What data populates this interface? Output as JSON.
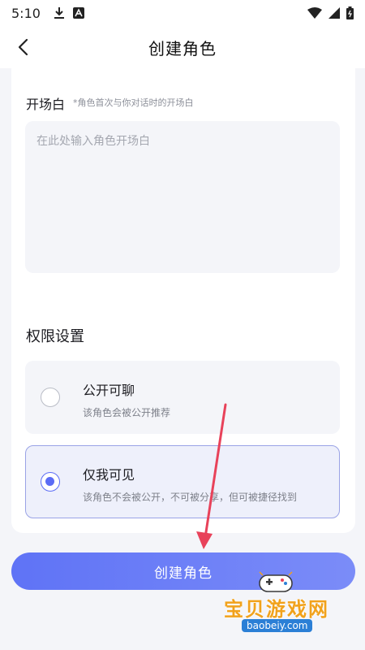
{
  "status_bar": {
    "time": "5:10"
  },
  "nav": {
    "title": "创建角色"
  },
  "opening": {
    "title": "开场白",
    "hint": "*角色首次与你对话时的开场白",
    "placeholder": "在此处输入角色开场白"
  },
  "permissions": {
    "title": "权限设置",
    "options": [
      {
        "label": "公开可聊",
        "desc": "该角色会被公开推荐",
        "selected": false
      },
      {
        "label": "仅我可见",
        "desc": "该角色不会被公开，不可被分享，但可被捷径找到",
        "selected": true
      }
    ]
  },
  "create_button": {
    "label": "创建角色"
  },
  "watermark": {
    "cn": "宝贝游戏网",
    "en": "baobeiy.com"
  },
  "colors": {
    "accent": "#5b6cf5",
    "annotation_arrow": "#e8425a"
  }
}
